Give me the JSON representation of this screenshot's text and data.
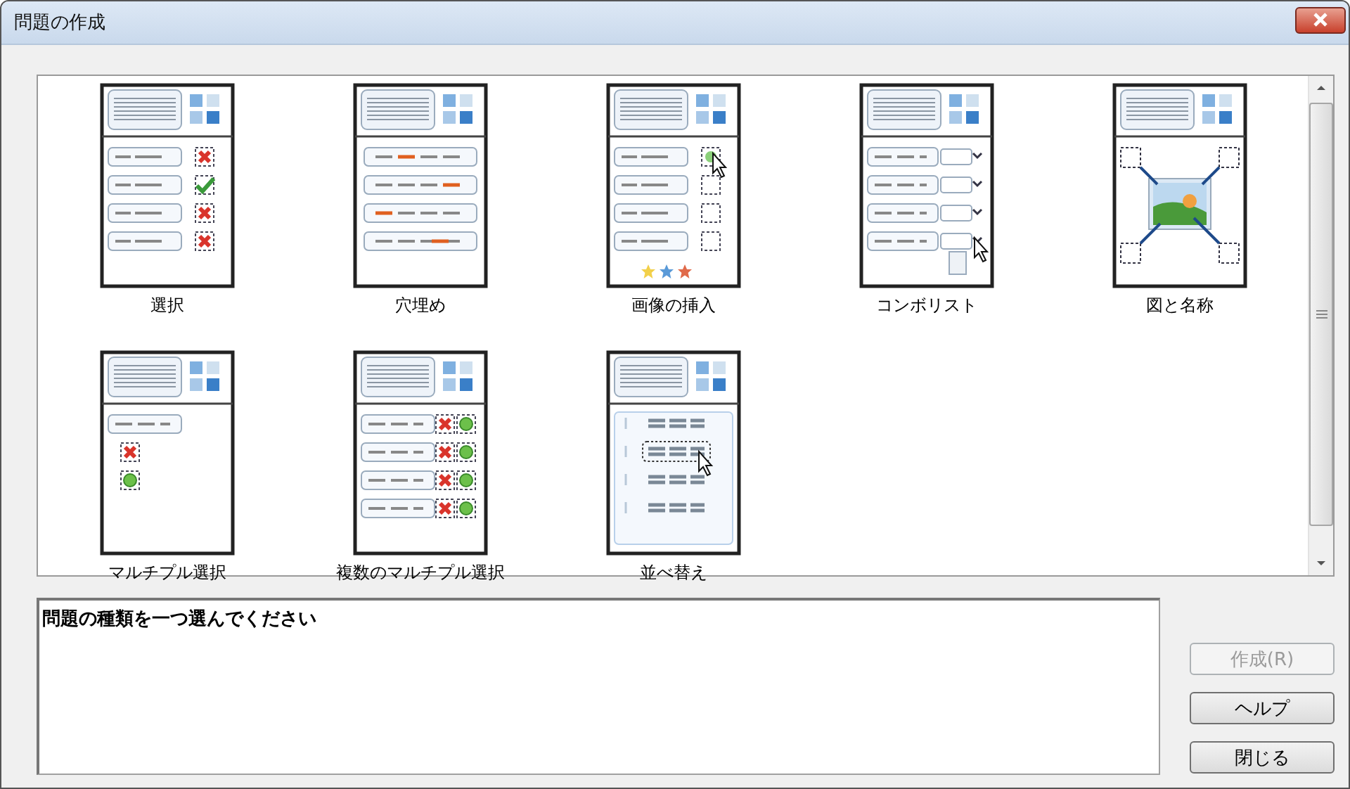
{
  "window": {
    "title": "問題の作成"
  },
  "question_types": [
    {
      "label": "選択",
      "kind": "choice",
      "selected": false
    },
    {
      "label": "穴埋め",
      "kind": "fill-blank",
      "selected": false
    },
    {
      "label": "画像の挿入",
      "kind": "image-insert",
      "selected": false
    },
    {
      "label": "コンボリスト",
      "kind": "combo",
      "selected": false
    },
    {
      "label": "図と名称",
      "kind": "diagram",
      "selected": false
    },
    {
      "label": "マルチプル選択",
      "kind": "multi-choice",
      "selected": false
    },
    {
      "label": "複数のマルチプル選択",
      "kind": "multi-choice-grid",
      "selected": false
    },
    {
      "label": "並べ替え",
      "kind": "ordering",
      "selected": false
    }
  ],
  "description": {
    "text": "問題の種類を一つ選んでください"
  },
  "buttons": [
    {
      "label": "作成(R)",
      "disabled": true
    },
    {
      "label": "ヘルプ",
      "disabled": false
    },
    {
      "label": "閉じる",
      "disabled": false
    }
  ]
}
